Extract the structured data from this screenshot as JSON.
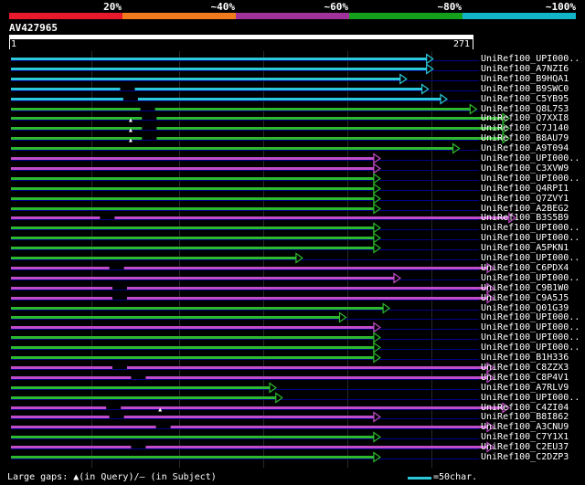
{
  "colors": {
    "background": "#000000",
    "line": "#00008b",
    "scale": [
      "#e8192c",
      "#f07a1e",
      "#a0329c",
      "#15a01c",
      "#12b4c8"
    ],
    "cyan": "#2ac8d8",
    "green": "#2db82d",
    "magenta": "#c04cc8",
    "label": "#ffffff"
  },
  "header": {
    "percent_ticks": [
      "20%",
      "~40%",
      "~60%",
      "~80%",
      "~100%"
    ],
    "query_id": "AV427965",
    "scale_start": "1",
    "scale_end": "271"
  },
  "footer": {
    "gaps_legend": "Large gaps: ▲(in Query)/– (in Subject)",
    "scale_legend": "=50char."
  },
  "hits": [
    {
      "label": "UniRef100_UPI000..",
      "end": 271,
      "color": "cyan",
      "gaps": []
    },
    {
      "label": "UniRef100_A7NZI6",
      "end": 271,
      "color": "cyan",
      "gaps": []
    },
    {
      "label": "UniRef100_B9HQA1",
      "end": 254,
      "color": "cyan",
      "gaps": []
    },
    {
      "label": "UniRef100_B9SWC0",
      "end": 268,
      "color": "cyan",
      "gaps": [
        {
          "pos": 75,
          "type": "subject"
        }
      ]
    },
    {
      "label": "UniRef100_C5YB95",
      "end": 280,
      "color": "cyan",
      "gaps": [
        {
          "pos": 77,
          "type": "subject"
        }
      ]
    },
    {
      "label": "UniRef100_Q8L7S3",
      "end": 299,
      "color": "green",
      "gaps": [
        {
          "pos": 88,
          "type": "subject"
        }
      ]
    },
    {
      "label": "UniRef100_Q7XXI8",
      "end": 320,
      "color": "green",
      "gaps": [
        {
          "pos": 77,
          "type": "query"
        },
        {
          "pos": 89,
          "type": "subject"
        }
      ]
    },
    {
      "label": "UniRef100_C7J140",
      "end": 320,
      "color": "green",
      "gaps": [
        {
          "pos": 77,
          "type": "query"
        },
        {
          "pos": 89,
          "type": "subject"
        }
      ]
    },
    {
      "label": "UniRef100_B8AU79",
      "end": 320,
      "color": "green",
      "gaps": [
        {
          "pos": 77,
          "type": "query"
        },
        {
          "pos": 89,
          "type": "subject"
        }
      ]
    },
    {
      "label": "UniRef100_A9T094",
      "end": 288,
      "color": "green",
      "gaps": []
    },
    {
      "label": "UniRef100_UPI000..",
      "end": 237,
      "color": "magenta",
      "gaps": []
    },
    {
      "label": "UniRef100_C3XVW9",
      "end": 237,
      "color": "magenta",
      "gaps": []
    },
    {
      "label": "UniRef100_UPI000..",
      "end": 237,
      "color": "green",
      "gaps": []
    },
    {
      "label": "UniRef100_Q4RPI1",
      "end": 237,
      "color": "green",
      "gaps": []
    },
    {
      "label": "UniRef100_Q7ZVY1",
      "end": 237,
      "color": "green",
      "gaps": []
    },
    {
      "label": "UniRef100_A2BEG2",
      "end": 237,
      "color": "green",
      "gaps": []
    },
    {
      "label": "UniRef100_B3S5B9",
      "end": 324,
      "color": "magenta",
      "gaps": [
        {
          "pos": 62,
          "type": "subject"
        }
      ]
    },
    {
      "label": "UniRef100_UPI000..",
      "end": 237,
      "color": "green",
      "gaps": []
    },
    {
      "label": "UniRef100_UPI000..",
      "end": 237,
      "color": "green",
      "gaps": []
    },
    {
      "label": "UniRef100_A5PKN1",
      "end": 237,
      "color": "green",
      "gaps": []
    },
    {
      "label": "UniRef100_UPI000..",
      "end": 187,
      "color": "green",
      "gaps": []
    },
    {
      "label": "UniRef100_C6PDX4",
      "end": 310,
      "color": "magenta",
      "gaps": [
        {
          "pos": 68,
          "type": "subject"
        }
      ]
    },
    {
      "label": "UniRef100_UPI000..",
      "end": 250,
      "color": "magenta",
      "gaps": []
    },
    {
      "label": "UniRef100_C9B1W0",
      "end": 310,
      "color": "magenta",
      "gaps": [
        {
          "pos": 70,
          "type": "subject"
        }
      ]
    },
    {
      "label": "UniRef100_C9A5J5",
      "end": 310,
      "color": "magenta",
      "gaps": [
        {
          "pos": 70,
          "type": "subject"
        }
      ]
    },
    {
      "label": "UniRef100_Q01G39",
      "end": 243,
      "color": "green",
      "gaps": []
    },
    {
      "label": "UniRef100_UPI000..",
      "end": 215,
      "color": "green",
      "gaps": []
    },
    {
      "label": "UniRef100_UPI000..",
      "end": 237,
      "color": "magenta",
      "gaps": []
    },
    {
      "label": "UniRef100_UPI000..",
      "end": 237,
      "color": "green",
      "gaps": []
    },
    {
      "label": "UniRef100_UPI000..",
      "end": 237,
      "color": "green",
      "gaps": []
    },
    {
      "label": "UniRef100_B1H336",
      "end": 237,
      "color": "green",
      "gaps": []
    },
    {
      "label": "UniRef100_C8ZZX3",
      "end": 310,
      "color": "magenta",
      "gaps": [
        {
          "pos": 70,
          "type": "subject"
        }
      ]
    },
    {
      "label": "UniRef100_C8P4V1",
      "end": 310,
      "color": "magenta",
      "gaps": [
        {
          "pos": 82,
          "type": "subject"
        }
      ]
    },
    {
      "label": "UniRef100_A7RLV9",
      "end": 170,
      "color": "green",
      "gaps": []
    },
    {
      "label": "UniRef100_UPI000..",
      "end": 174,
      "color": "green",
      "gaps": []
    },
    {
      "label": "UniRef100_C4ZI04",
      "end": 320,
      "color": "magenta",
      "gaps": [
        {
          "pos": 66,
          "type": "subject"
        },
        {
          "pos": 96,
          "type": "query"
        }
      ]
    },
    {
      "label": "UniRef100_B8I862",
      "end": 237,
      "color": "magenta",
      "gaps": [
        {
          "pos": 68,
          "type": "subject"
        }
      ]
    },
    {
      "label": "UniRef100_A3CNU9",
      "end": 310,
      "color": "magenta",
      "gaps": [
        {
          "pos": 98,
          "type": "subject"
        }
      ]
    },
    {
      "label": "UniRef100_C7Y1X1",
      "end": 237,
      "color": "green",
      "gaps": []
    },
    {
      "label": "UniRef100_C2EU37",
      "end": 310,
      "color": "magenta",
      "gaps": [
        {
          "pos": 82,
          "type": "subject"
        }
      ]
    },
    {
      "label": "UniRef100_C2DZP3",
      "end": 237,
      "color": "green",
      "gaps": []
    }
  ]
}
